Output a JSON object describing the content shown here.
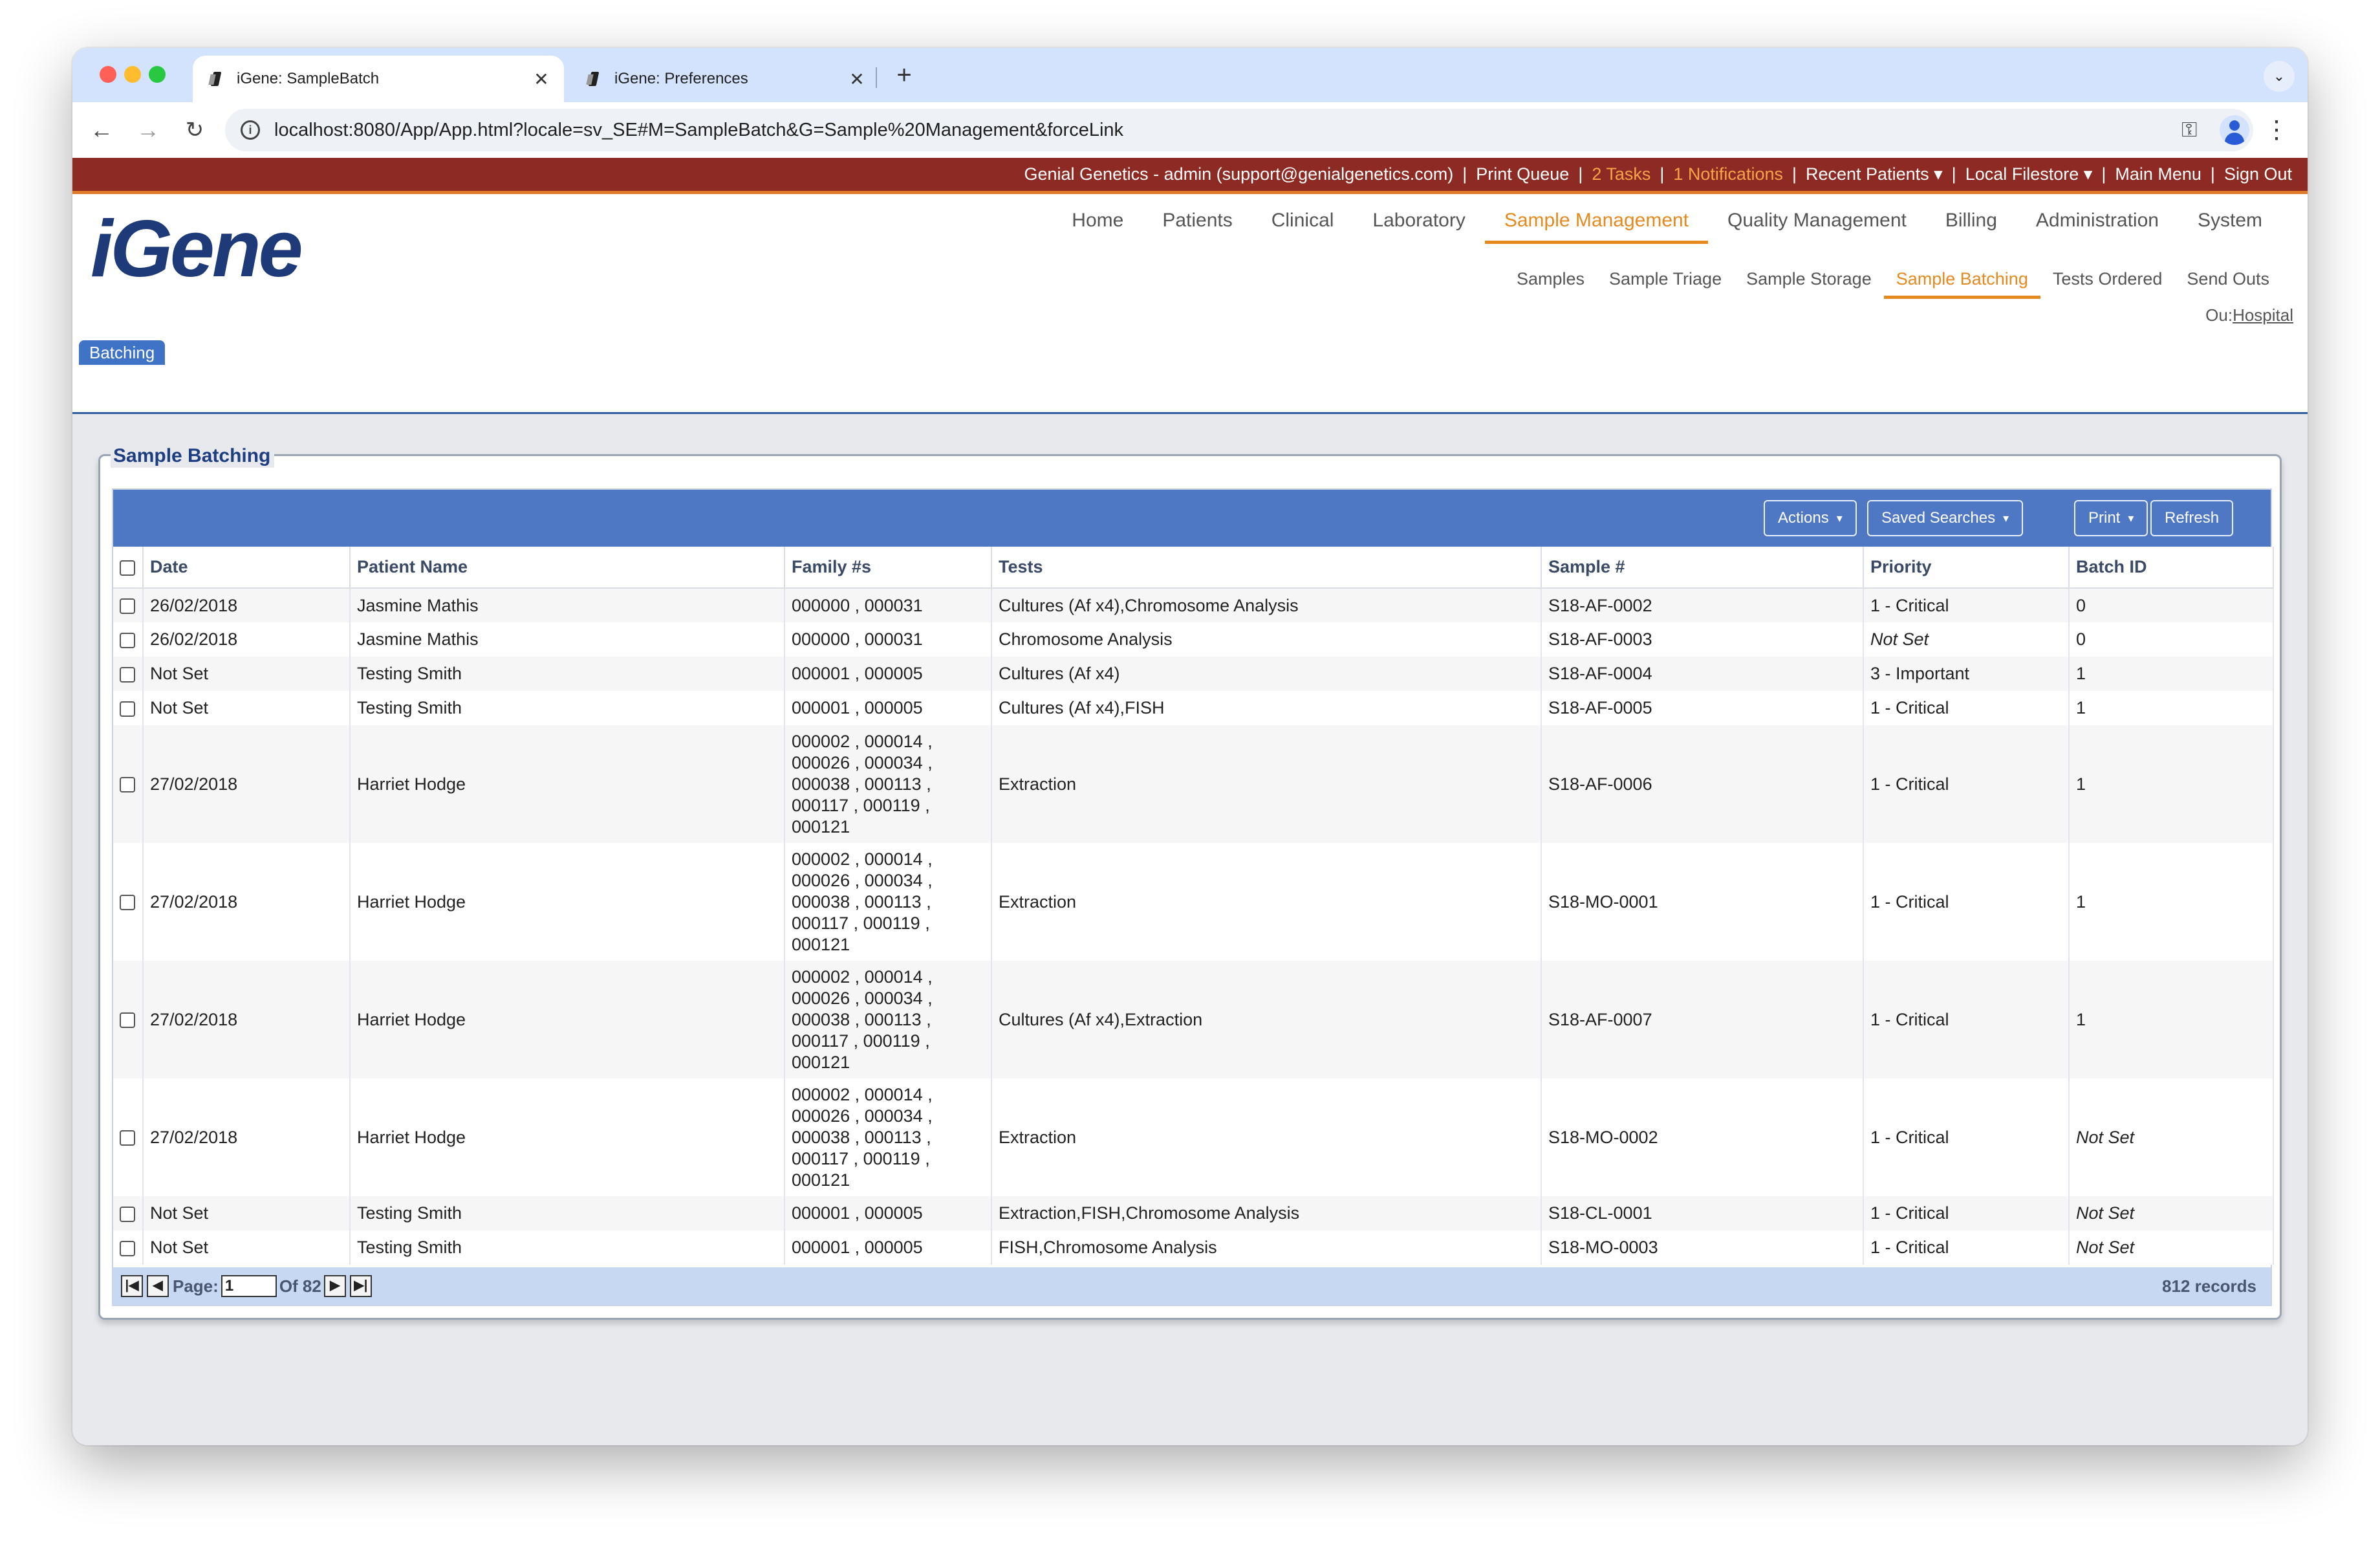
{
  "browser": {
    "tabs": [
      {
        "title": "iGene: SampleBatch",
        "close": "✕"
      },
      {
        "title": "iGene: Preferences",
        "close": "✕"
      }
    ],
    "new_tab": "+",
    "tab_menu": "⌄",
    "url": "localhost:8080/App/App.html?locale=sv_SE#M=SampleBatch&G=Sample%20Management&forceLink",
    "icons": [
      "back-icon",
      "forward-icon",
      "reload-icon",
      "info-icon",
      "password-key-icon",
      "star-icon",
      "profile-icon",
      "kebab-menu-icon"
    ]
  },
  "topbar": {
    "account": "Genial Genetics - admin (support@genialgenetics.com)",
    "print_queue": "Print Queue",
    "tasks": "2 Tasks",
    "notifications": "1 Notifications",
    "recent_patients": "Recent Patients ▾",
    "local_filestore": "Local Filestore ▾",
    "main_menu": "Main Menu",
    "sign_out": "Sign Out",
    "sep": "|",
    "colors": {
      "bar": "#8d2a24",
      "highlight": "#f6a34a"
    }
  },
  "header": {
    "logo": "iGene",
    "main_nav": [
      "Home",
      "Patients",
      "Clinical",
      "Laboratory",
      "Sample Management",
      "Quality Management",
      "Billing",
      "Administration",
      "System"
    ],
    "main_nav_active": "Sample Management",
    "sub_nav": [
      "Samples",
      "Sample Triage",
      "Sample Storage",
      "Sample Batching",
      "Tests Ordered",
      "Send Outs"
    ],
    "sub_nav_active": "Sample Batching",
    "ou_label": "Ou:",
    "ou_value": "Hospital",
    "batch_tab": "Batching"
  },
  "panel": {
    "title": "Sample Batching",
    "buttons": {
      "actions": "Actions",
      "saved_searches": "Saved Searches",
      "print": "Print",
      "refresh": "Refresh",
      "caret": "▾"
    },
    "columns": [
      "Date",
      "Patient Name",
      "Family #s",
      "Tests",
      "Sample #",
      "Priority",
      "Batch ID"
    ],
    "rows": [
      {
        "date": "26/02/2018",
        "patient": "Jasmine Mathis",
        "family": "000000 , 000031",
        "tests": "Cultures (Af x4),Chromosome Analysis",
        "sample": "S18-AF-0002",
        "priority": "1 - Critical",
        "batch": "0"
      },
      {
        "date": "26/02/2018",
        "patient": "Jasmine Mathis",
        "family": "000000 , 000031",
        "tests": "Chromosome Analysis",
        "sample": "S18-AF-0003",
        "priority": "Not Set",
        "batch": "0"
      },
      {
        "date": "Not Set",
        "patient": "Testing Smith",
        "family": "000001 , 000005",
        "tests": "Cultures (Af x4)",
        "sample": "S18-AF-0004",
        "priority": "3 - Important",
        "batch": "1"
      },
      {
        "date": "Not Set",
        "patient": "Testing Smith",
        "family": "000001 , 000005",
        "tests": "Cultures (Af x4),FISH",
        "sample": "S18-AF-0005",
        "priority": "1 - Critical",
        "batch": "1"
      },
      {
        "date": "27/02/2018",
        "patient": "Harriet Hodge",
        "family": "000002 , 000014 ,\n000026 , 000034 ,\n000038 , 000113 ,\n000117 , 000119 ,\n000121",
        "tests": "Extraction",
        "sample": "S18-AF-0006",
        "priority": "1 - Critical",
        "batch": "1"
      },
      {
        "date": "27/02/2018",
        "patient": "Harriet Hodge",
        "family": "000002 , 000014 ,\n000026 , 000034 ,\n000038 , 000113 ,\n000117 , 000119 ,\n000121",
        "tests": "Extraction",
        "sample": "S18-MO-0001",
        "priority": "1 - Critical",
        "batch": "1"
      },
      {
        "date": "27/02/2018",
        "patient": "Harriet Hodge",
        "family": "000002 , 000014 ,\n000026 , 000034 ,\n000038 , 000113 ,\n000117 , 000119 ,\n000121",
        "tests": "Cultures (Af x4),Extraction",
        "sample": "S18-AF-0007",
        "priority": "1 - Critical",
        "batch": "1"
      },
      {
        "date": "27/02/2018",
        "patient": "Harriet Hodge",
        "family": "000002 , 000014 ,\n000026 , 000034 ,\n000038 , 000113 ,\n000117 , 000119 ,\n000121",
        "tests": "Extraction",
        "sample": "S18-MO-0002",
        "priority": "1 - Critical",
        "batch": "Not Set"
      },
      {
        "date": "Not Set",
        "patient": "Testing Smith",
        "family": "000001 , 000005",
        "tests": "Extraction,FISH,Chromosome Analysis",
        "sample": "S18-CL-0001",
        "priority": "1 - Critical",
        "batch": "Not Set"
      },
      {
        "date": "Not Set",
        "patient": "Testing Smith",
        "family": "000001 , 000005",
        "tests": "FISH,Chromosome Analysis",
        "sample": "S18-MO-0003",
        "priority": "1 - Critical",
        "batch": "Not Set"
      }
    ],
    "pager": {
      "page_label": "Page:",
      "page_value": "1",
      "of_label": "Of 82",
      "records": "812 records"
    }
  }
}
